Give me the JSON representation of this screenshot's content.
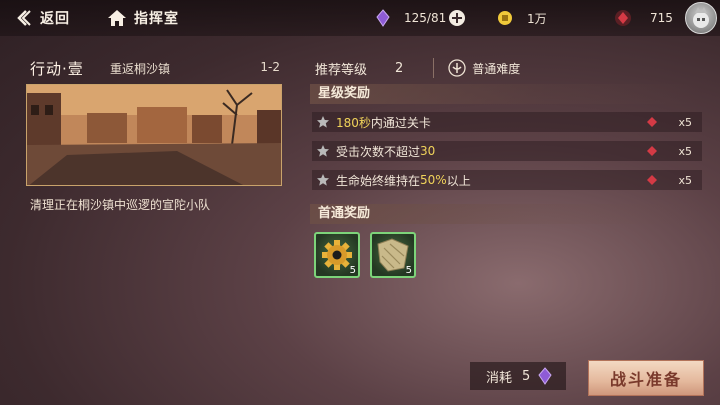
{
  "topbar": {
    "back_label": "返回",
    "home_label": "指挥室",
    "stamina": "125/81",
    "coins": "1万",
    "gems": "715"
  },
  "stage": {
    "name": "行动·壹",
    "subtitle": "重返桐沙镇",
    "code": "1-2",
    "description": "清理正在桐沙镇中巡逻的宣陀小队"
  },
  "info": {
    "recommended_label": "推荐等级",
    "recommended_value": "2",
    "difficulty_label": "普通难度"
  },
  "star_rewards": {
    "title": "星级奖励",
    "conditions": [
      {
        "pre": "",
        "hl": "180秒",
        "post": "内通过关卡",
        "reward": "x5"
      },
      {
        "pre": "受击次数不超过",
        "hl": "30",
        "post": "",
        "reward": "x5"
      },
      {
        "pre": "生命始终维持在",
        "hl": "50%",
        "post": "以上",
        "reward": "x5"
      }
    ]
  },
  "first_clear": {
    "title": "首通奖励",
    "items": [
      {
        "icon": "gear-icon",
        "count": "5"
      },
      {
        "icon": "cloth-icon",
        "count": "5"
      }
    ]
  },
  "footer": {
    "cost_label": "消耗",
    "cost_value": "5",
    "start_button": "战斗准备"
  },
  "colors": {
    "highlight": "#f0d35a",
    "accent_red": "#d43a45",
    "stamina_purple": "#8e5bd6",
    "item_border": "#7dd47a"
  }
}
